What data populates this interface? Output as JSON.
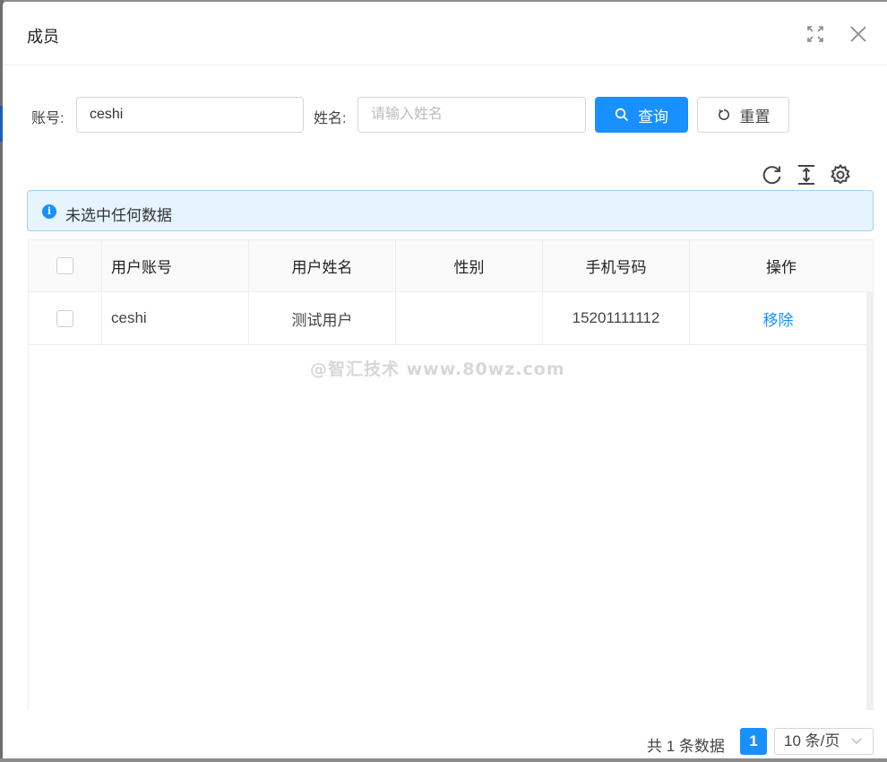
{
  "modal": {
    "title": "成员"
  },
  "search": {
    "account_label": "账号",
    "account_value": "ceshi",
    "name_label": "姓名",
    "name_placeholder": "请输入姓名",
    "query_label": "查询",
    "reset_label": "重置"
  },
  "toolbar": {
    "icons": [
      "refresh-icon",
      "column-height-icon",
      "settings-icon"
    ]
  },
  "alert": {
    "text": "未选中任何数据"
  },
  "table": {
    "columns": [
      "用户账号",
      "用户姓名",
      "性别",
      "手机号码",
      "操作"
    ],
    "rows": [
      {
        "account": "ceshi",
        "name": "测试用户",
        "gender": "",
        "phone": "15201111112",
        "action": "移除"
      }
    ]
  },
  "watermark": "@智汇技术 www.80wz.com",
  "pagination": {
    "total": "共 1 条数据",
    "current_page": "1",
    "page_size": "10 条/页"
  },
  "colors": {
    "primary": "#1890ff",
    "alert_bg": "#e6f4fd",
    "alert_border": "#9fd4f7"
  }
}
